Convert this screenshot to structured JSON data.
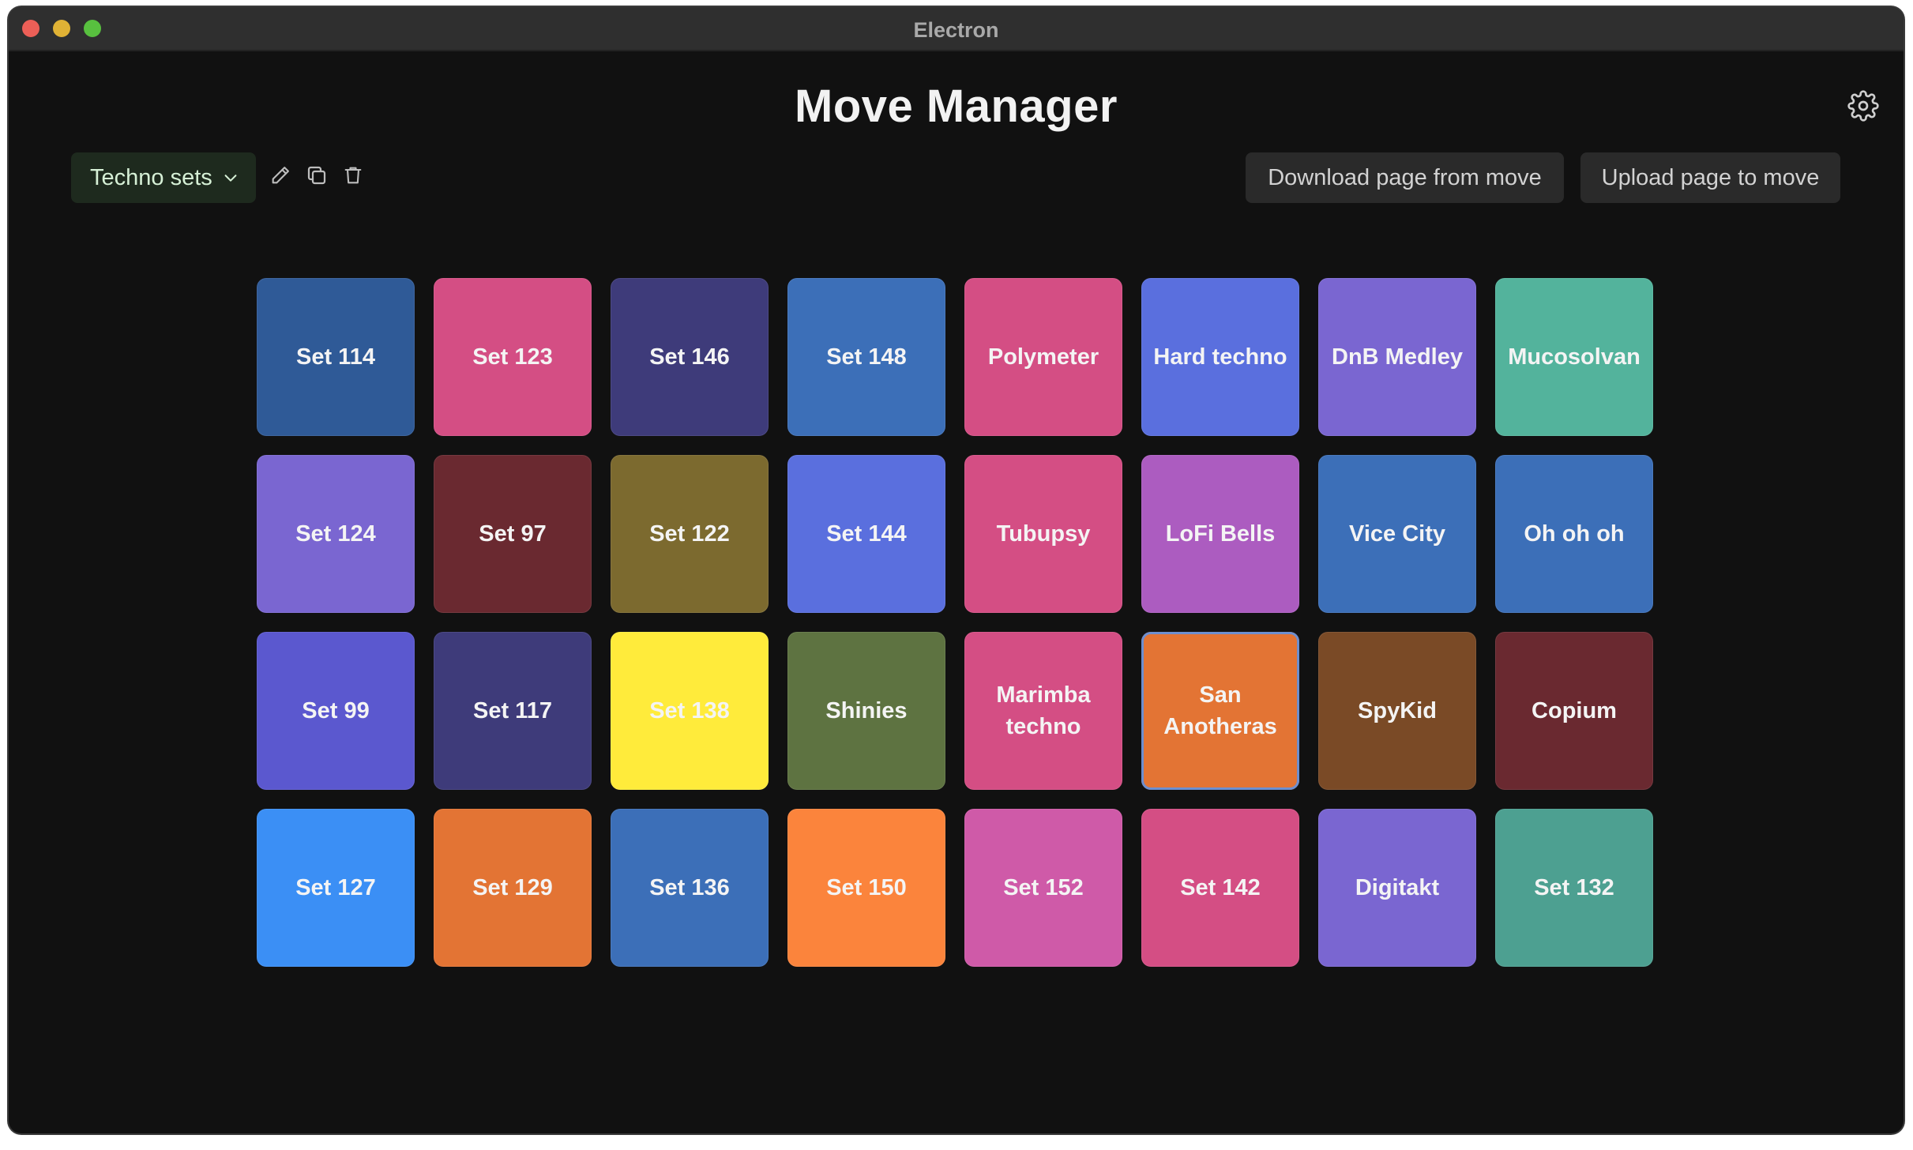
{
  "window": {
    "title": "Electron"
  },
  "header": {
    "title": "Move Manager",
    "settings_icon": "gear-icon"
  },
  "toolbar": {
    "set_selector_label": "Techno sets",
    "set_selector_icon": "chevron-down-icon",
    "rename_icon": "pencil-icon",
    "duplicate_icon": "copy-icon",
    "delete_icon": "trash-icon",
    "download_label": "Download page from move",
    "upload_label": "Upload page to move"
  },
  "pads": [
    {
      "label": "Set 114",
      "color": "#2f5a97"
    },
    {
      "label": "Set 123",
      "color": "#d44e84"
    },
    {
      "label": "Set 146",
      "color": "#3e3b7a"
    },
    {
      "label": "Set 148",
      "color": "#3c6fb8"
    },
    {
      "label": "Polymeter",
      "color": "#d44e84"
    },
    {
      "label": "Hard techno",
      "color": "#5a6fde"
    },
    {
      "label": "DnB Medley",
      "color": "#7a66d1"
    },
    {
      "label": "Mucosolvan",
      "color": "#53b39c"
    },
    {
      "label": "Set 124",
      "color": "#7a66d1"
    },
    {
      "label": "Set 97",
      "color": "#6a2930"
    },
    {
      "label": "Set 122",
      "color": "#7c6a2f"
    },
    {
      "label": "Set 144",
      "color": "#5a6fde"
    },
    {
      "label": "Tubupsy",
      "color": "#d44e84"
    },
    {
      "label": "LoFi Bells",
      "color": "#ac5cc0"
    },
    {
      "label": "Vice City",
      "color": "#3c6fb8"
    },
    {
      "label": "Oh oh oh",
      "color": "#3c6fb8"
    },
    {
      "label": "Set 99",
      "color": "#5b58cf"
    },
    {
      "label": "Set 117",
      "color": "#3e3b7a"
    },
    {
      "label": "Set 138",
      "color": "#ffeb3b"
    },
    {
      "label": "Shinies",
      "color": "#5e7341"
    },
    {
      "label": "Marimba techno",
      "color": "#d44e84"
    },
    {
      "label": "San Anotheras",
      "color": "#e37434",
      "selected": true
    },
    {
      "label": "SpyKid",
      "color": "#7a4a26"
    },
    {
      "label": "Copium",
      "color": "#6a2930"
    },
    {
      "label": "Set 127",
      "color": "#3b8ff5"
    },
    {
      "label": "Set 129",
      "color": "#e37434"
    },
    {
      "label": "Set 136",
      "color": "#3c6fb8"
    },
    {
      "label": "Set 150",
      "color": "#fb843c"
    },
    {
      "label": "Set 152",
      "color": "#cf5aa8"
    },
    {
      "label": "Set 142",
      "color": "#d44e84"
    },
    {
      "label": "Digitakt",
      "color": "#7a66d1"
    },
    {
      "label": "Set 132",
      "color": "#4da091"
    }
  ]
}
